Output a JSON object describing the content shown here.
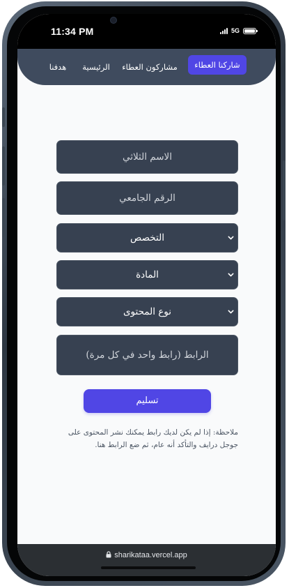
{
  "status_bar": {
    "time": "11:34 PM",
    "network": "5G"
  },
  "nav": {
    "items": [
      {
        "label": "شاركنا العطاء",
        "active": true
      },
      {
        "label": "مشاركون العطاء",
        "active": false
      },
      {
        "label": "الرئيسية",
        "active": false
      },
      {
        "label": "هدفنا",
        "active": false
      }
    ]
  },
  "form": {
    "full_name_placeholder": "الاسم الثلاثي",
    "university_id_placeholder": "الرقم الجامعي",
    "specialization_select": "التخصص",
    "subject_select": "المادة",
    "content_type_select": "نوع المحتوى",
    "link_placeholder": "الرابط (رابط واحد في كل مرة)",
    "submit_label": "تسليم",
    "note": "ملاحظة: إذا لم يكن لديك رابط يمكنك نشر المحتوى على جوجل درايف والتأكد أنه عام، ثم ضع الرابط هنا."
  },
  "browser": {
    "url": "sharikataa.vercel.app"
  },
  "icons": {
    "chevron": "chevron-down-icon",
    "lock": "lock-icon",
    "signal": "signal-icon",
    "battery": "battery-icon"
  },
  "colors": {
    "accent": "#5046e5",
    "navbar": "#3f4b5e",
    "field_bg": "#374151",
    "page_bg": "#f9fafb"
  }
}
